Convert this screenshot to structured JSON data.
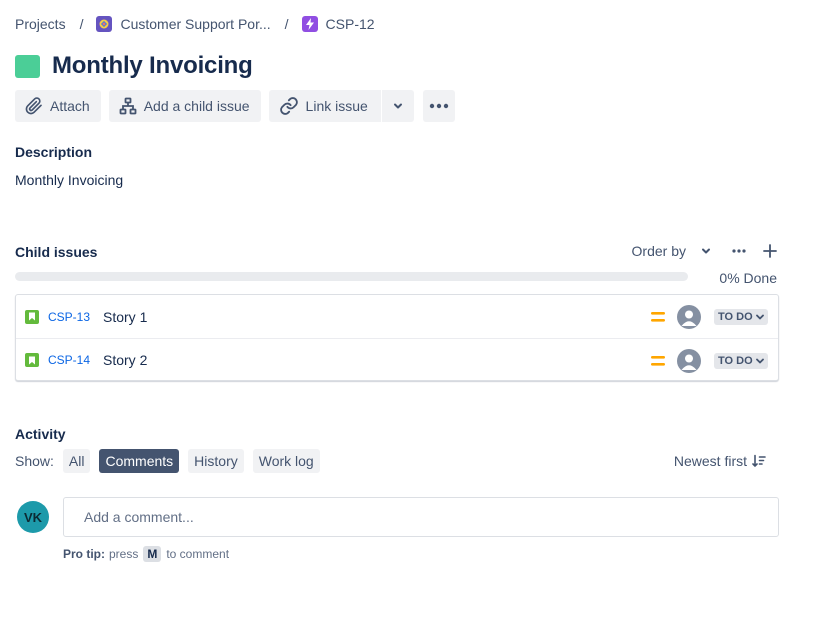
{
  "breadcrumb": {
    "projects": "Projects",
    "project_name": "Customer Support Por...",
    "issue_key": "CSP-12",
    "separator": "/"
  },
  "issue": {
    "title": "Monthly Invoicing",
    "title_icon_color": "#4bce97"
  },
  "toolbar": {
    "attach_label": "Attach",
    "add_child_label": "Add a child issue",
    "link_issue_label": "Link issue"
  },
  "description": {
    "label": "Description",
    "text": "Monthly Invoicing"
  },
  "child_issues": {
    "label": "Child issues",
    "order_by_label": "Order by",
    "progress_fraction": 0,
    "progress_label": "0% Done",
    "items": [
      {
        "key": "CSP-13",
        "summary": "Story 1",
        "priority": "medium",
        "status": "TO DO"
      },
      {
        "key": "CSP-14",
        "summary": "Story 2",
        "priority": "medium",
        "status": "TO DO"
      }
    ]
  },
  "activity": {
    "label": "Activity",
    "show_label": "Show:",
    "filters": [
      {
        "label": "All",
        "active": false
      },
      {
        "label": "Comments",
        "active": true
      },
      {
        "label": "History",
        "active": false
      },
      {
        "label": "Work log",
        "active": false
      }
    ],
    "sort_label": "Newest first"
  },
  "comment": {
    "avatar_initials": "VK",
    "placeholder": "Add a comment...",
    "pro_tip_label": "Pro tip:",
    "pro_tip_pre": "press",
    "pro_tip_key": "M",
    "pro_tip_post": "to comment"
  },
  "colors": {
    "accent": "#0c66e4",
    "story": "#63ba3c",
    "priority_medium": "#ffa600",
    "avatar_vk": "#1d9aaa",
    "active_filter": "#44546f"
  }
}
